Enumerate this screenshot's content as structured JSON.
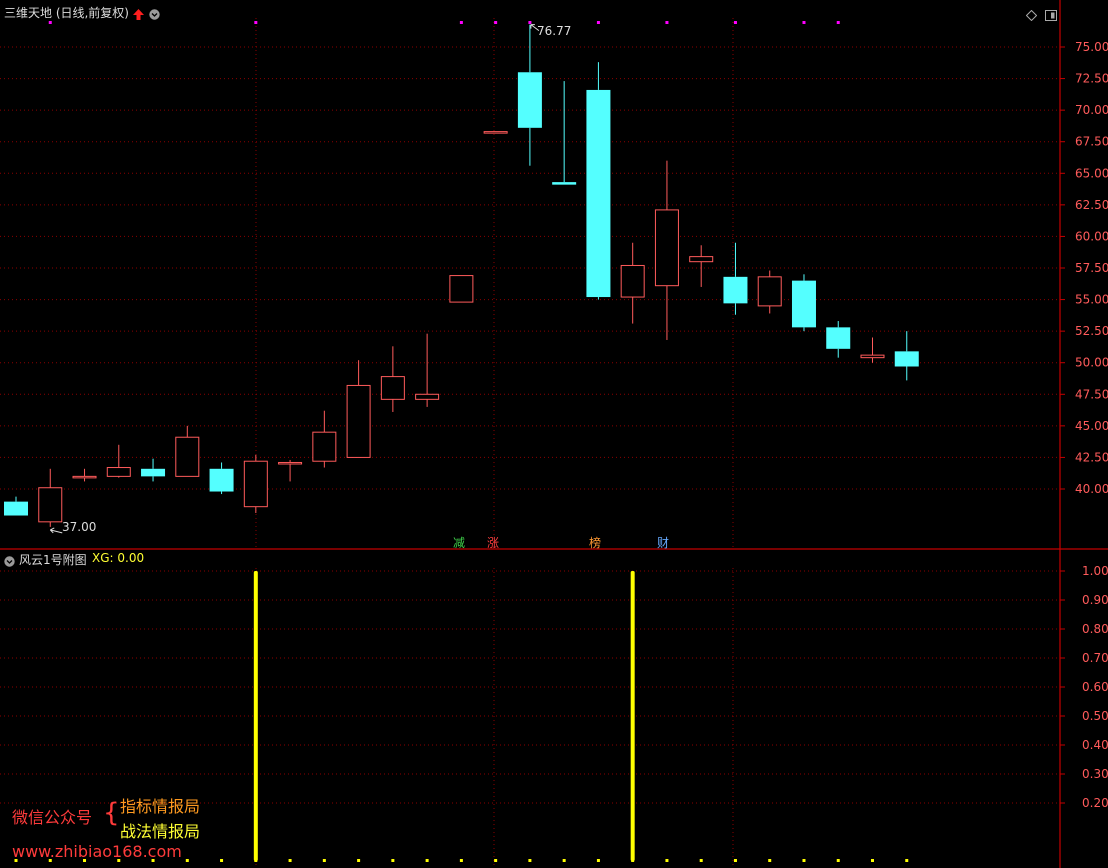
{
  "main_panel": {
    "title": "三维天地 (日线,前复权)",
    "max_label": "76.77",
    "min_label": "37.00",
    "event_markers": [
      "减",
      "涨",
      "榜",
      "财"
    ]
  },
  "sub_panel": {
    "title": "风云1号附图",
    "indicator_label": "XG: 0.00"
  },
  "watermark": {
    "left": "微信公众号",
    "line1": "指标情报局",
    "line2": "战法情报局",
    "url": "www.zhibiao168.com"
  },
  "colors": {
    "up": "#ff5b5b",
    "down": "#54ffff",
    "grid": "#8b0000",
    "signal": "#ffff00",
    "marker": "#ff00ff"
  },
  "chart_data": [
    {
      "type": "candlestick",
      "title": "三维天地 (日线,前复权)",
      "y_ticks": [
        75,
        72.5,
        70,
        67.5,
        65,
        62.5,
        60,
        57.5,
        55,
        52.5,
        50,
        47.5,
        45,
        42.5,
        40
      ],
      "y_tick_labels": [
        "75.00",
        "72.50",
        "70.00",
        "67.50",
        "65.00",
        "62.50",
        "60.00",
        "57.50",
        "55.00",
        "52.50",
        "50.00",
        "47.50",
        "45.00",
        "42.50",
        "40.00"
      ],
      "ylim": [
        36.5,
        78
      ],
      "candles": [
        {
          "o": 39.0,
          "h": 39.4,
          "l": 37.9,
          "c": 37.9
        },
        {
          "o": 37.4,
          "h": 41.6,
          "l": 37.0,
          "c": 40.1
        },
        {
          "o": 40.9,
          "h": 41.6,
          "l": 40.6,
          "c": 41.0
        },
        {
          "o": 41.0,
          "h": 43.5,
          "l": 40.9,
          "c": 41.7
        },
        {
          "o": 41.6,
          "h": 42.4,
          "l": 40.6,
          "c": 41.0
        },
        {
          "o": 41.0,
          "h": 45.0,
          "l": 41.0,
          "c": 44.1
        },
        {
          "o": 41.6,
          "h": 42.1,
          "l": 39.6,
          "c": 39.8
        },
        {
          "o": 38.6,
          "h": 42.7,
          "l": 38.1,
          "c": 42.2
        },
        {
          "o": 42.0,
          "h": 42.3,
          "l": 40.6,
          "c": 42.1
        },
        {
          "o": 42.2,
          "h": 46.2,
          "l": 41.7,
          "c": 44.5
        },
        {
          "o": 42.5,
          "h": 50.2,
          "l": 42.5,
          "c": 48.2
        },
        {
          "o": 47.1,
          "h": 51.3,
          "l": 46.1,
          "c": 48.9
        },
        {
          "o": 47.1,
          "h": 52.3,
          "l": 46.5,
          "c": 47.5
        },
        {
          "o": 54.8,
          "h": 56.9,
          "l": 54.8,
          "c": 56.9
        },
        {
          "o": 68.3,
          "h": 68.3,
          "l": 68.3,
          "c": 68.3
        },
        {
          "o": 73.0,
          "h": 76.77,
          "l": 65.6,
          "c": 68.6
        },
        {
          "o": 64.3,
          "h": 72.3,
          "l": 64.1,
          "c": 64.1
        },
        {
          "o": 71.6,
          "h": 73.8,
          "l": 55.0,
          "c": 55.2
        },
        {
          "o": 55.2,
          "h": 59.5,
          "l": 53.1,
          "c": 57.7
        },
        {
          "o": 56.1,
          "h": 66.0,
          "l": 51.8,
          "c": 62.1
        },
        {
          "o": 58.0,
          "h": 59.3,
          "l": 56.0,
          "c": 58.4
        },
        {
          "o": 56.8,
          "h": 59.5,
          "l": 53.8,
          "c": 54.7
        },
        {
          "o": 54.5,
          "h": 57.3,
          "l": 53.9,
          "c": 56.8
        },
        {
          "o": 56.5,
          "h": 57.0,
          "l": 52.5,
          "c": 52.8
        },
        {
          "o": 52.8,
          "h": 53.3,
          "l": 50.4,
          "c": 51.1
        },
        {
          "o": 50.4,
          "h": 52.0,
          "l": 50.0,
          "c": 50.6
        },
        {
          "o": 50.9,
          "h": 52.5,
          "l": 48.6,
          "c": 49.7
        }
      ]
    },
    {
      "type": "bar",
      "title": "风云1号附图",
      "series": [
        {
          "name": "XG",
          "values": [
            0,
            0,
            0,
            0,
            0,
            0,
            0,
            1,
            0,
            0,
            0,
            0,
            0,
            0,
            0,
            0,
            0,
            0,
            1,
            0,
            0,
            0,
            0,
            0,
            0,
            0,
            0
          ]
        }
      ],
      "y_ticks": [
        1.0,
        0.9,
        0.8,
        0.7,
        0.6,
        0.5,
        0.4,
        0.3,
        0.2
      ],
      "y_tick_labels": [
        "1.00",
        "0.90",
        "0.80",
        "0.70",
        "0.60",
        "0.50",
        "0.40",
        "0.30",
        "0.20"
      ],
      "ylim": [
        0,
        1.0
      ]
    }
  ]
}
